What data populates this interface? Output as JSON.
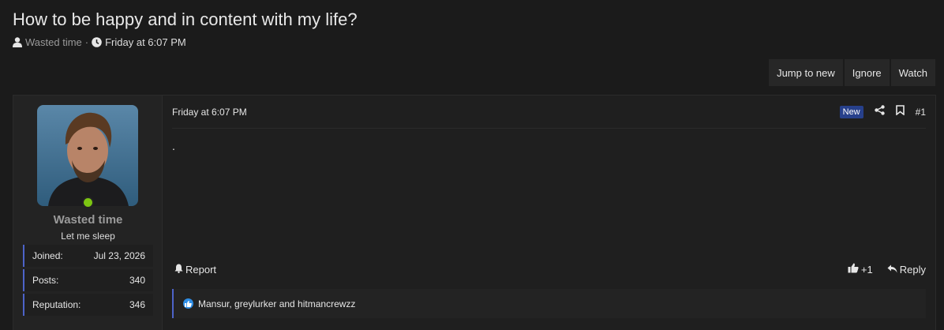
{
  "thread": {
    "title": "How to be happy and in content with my life?",
    "author": "Wasted time",
    "separator": "·",
    "date": "Friday at 6:07 PM"
  },
  "actions": [
    "Jump to new",
    "Ignore",
    "Watch"
  ],
  "user": {
    "name": "Wasted time",
    "title": "Let me sleep",
    "online_color": "#7cc512",
    "stats": [
      {
        "label": "Joined:",
        "value": "Jul 23, 2026"
      },
      {
        "label": "Posts:",
        "value": "340"
      },
      {
        "label": "Reputation:",
        "value": "346"
      }
    ]
  },
  "post": {
    "date": "Friday at 6:07 PM",
    "badge": "New",
    "number": "#1",
    "body": ".",
    "report_label": "Report",
    "like_count": "+1",
    "reply_label": "Reply",
    "reactions_text": "Mansur, greylurker and hitmancrewzz"
  },
  "colors": {
    "accent_bar": "#4d63c9",
    "badge_new": "#27408b",
    "like": "#2f8ee6"
  }
}
